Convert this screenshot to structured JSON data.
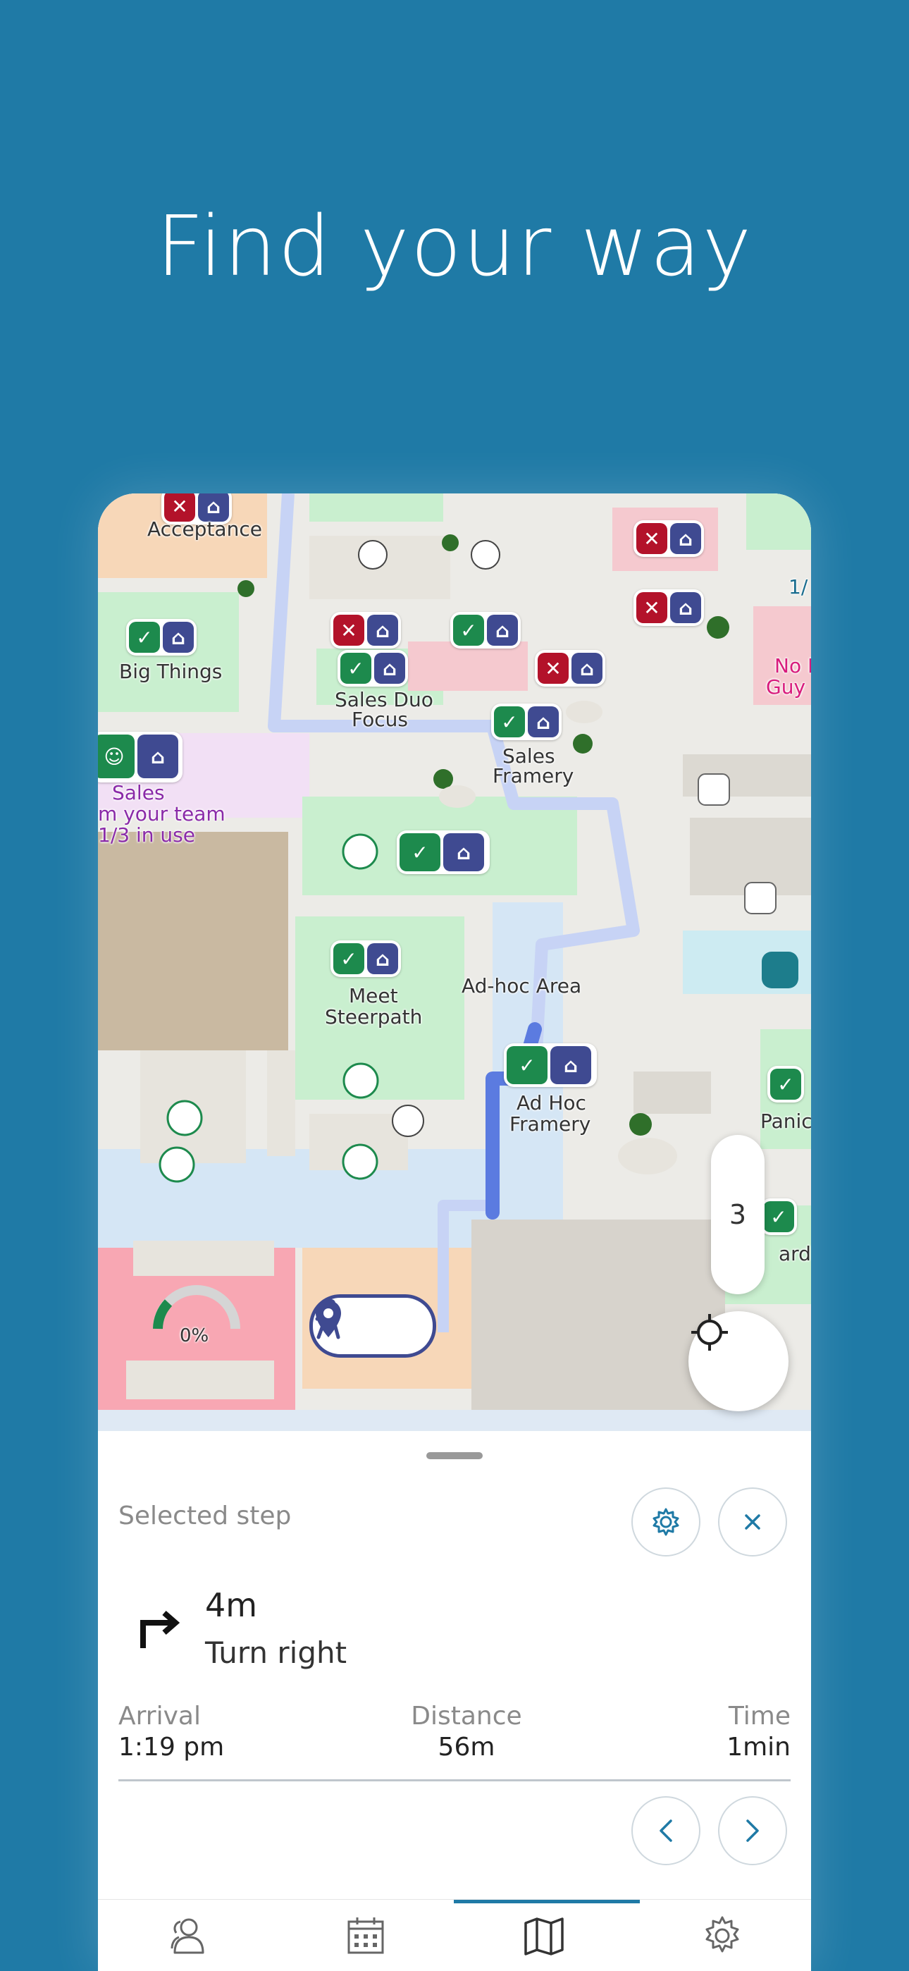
{
  "headline": "Find your way",
  "map": {
    "labels": {
      "acceptance": "Acceptance",
      "big_things": "Big Things",
      "sales_duo": "Sales Duo",
      "focus": "Focus",
      "sales_framery_1": "Sales",
      "sales_framery_2": "Framery",
      "sales_area_1": "Sales",
      "sales_area_2": "m your team",
      "sales_area_3": "1/3 in use",
      "meet_1": "Meet",
      "meet_2": "Steerpath",
      "adhoc_area": "Ad-hoc Area",
      "adhoc_framery_1": "Ad Hoc",
      "adhoc_framery_2": "Framery",
      "no_guy_1": "No F",
      "no_guy_2": "Guy L",
      "panic": "Panic",
      "fraction": "1/",
      "ard": "ard",
      "occupancy": "0%"
    },
    "floor": "3"
  },
  "sheet": {
    "selected_step_label": "Selected step",
    "step_distance": "4m",
    "step_instruction": "Turn right",
    "arrival_label": "Arrival",
    "arrival_value": "1:19 pm",
    "distance_label": "Distance",
    "distance_value": "56m",
    "time_label": "Time",
    "time_value": "1min"
  },
  "tabs": [
    {
      "icon": "people-icon",
      "active": false
    },
    {
      "icon": "calendar-icon",
      "active": false
    },
    {
      "icon": "map-icon",
      "active": true
    },
    {
      "icon": "settings-icon",
      "active": false
    }
  ],
  "colors": {
    "background": "#1f7aa6",
    "accent": "#1f7aa6",
    "available": "#1d8a4d",
    "busy": "#b3122a",
    "room": "#3f4a91",
    "route": "#5b7be0"
  }
}
